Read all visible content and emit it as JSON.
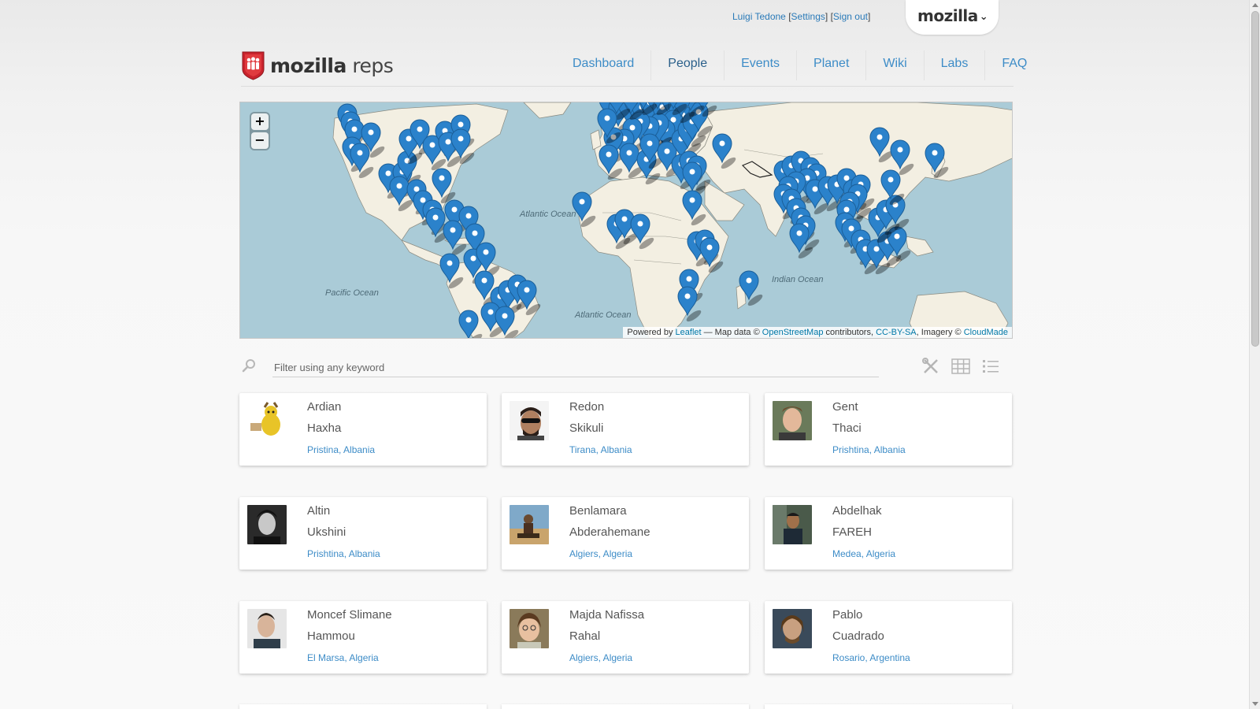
{
  "user_bar": {
    "name": "Luigi Tedone",
    "settings": "Settings",
    "signout": "Sign out"
  },
  "mozilla_tab": {
    "label": "mozilla"
  },
  "logo": {
    "bold": "mozilla",
    "light": "reps"
  },
  "nav": {
    "items": [
      {
        "label": "Dashboard",
        "active": false
      },
      {
        "label": "People",
        "active": true
      },
      {
        "label": "Events",
        "active": false
      },
      {
        "label": "Planet",
        "active": false
      },
      {
        "label": "Wiki",
        "active": false
      },
      {
        "label": "Labs",
        "active": false
      },
      {
        "label": "FAQ",
        "active": false
      }
    ]
  },
  "map": {
    "zoom_in": "+",
    "zoom_out": "−",
    "oceans": [
      {
        "label": "Atlantic Ocean"
      },
      {
        "label": "Pacific Ocean"
      },
      {
        "label": "Atlantic Ocean"
      },
      {
        "label": "Indian Ocean"
      }
    ],
    "attribution": {
      "prefix": "Powered by",
      "leaflet": "Leaflet",
      "mid": "— Map data ©",
      "osm": "OpenStreetMap",
      "contributors": "contributors,",
      "license": "CC-BY-SA",
      "imagery": ", Imagery ©",
      "cloudmade": "CloudMade"
    },
    "colors": {
      "water": "#aacbd7",
      "land": "#f3efe2",
      "marker": "#2b82cb"
    }
  },
  "search": {
    "placeholder": "Filter using any keyword",
    "value": ""
  },
  "view_icons": [
    "tools-icon",
    "grid-view-icon",
    "list-view-icon"
  ],
  "reps": [
    {
      "first": "Ardian",
      "last": "Haxha",
      "location": "Pristina, Albania"
    },
    {
      "first": "Redon",
      "last": "Skikuli",
      "location": "Tirana, Albania"
    },
    {
      "first": "Gent",
      "last": "Thaci",
      "location": "Prishtina, Albania"
    },
    {
      "first": "Altin",
      "last": "Ukshini",
      "location": "Prishtina, Albania"
    },
    {
      "first": "Benlamara",
      "last": "Abderahemane",
      "location": "Algiers, Algeria"
    },
    {
      "first": "Abdelhak",
      "last": "FAREH",
      "location": "Medea, Algeria"
    },
    {
      "first": "Moncef Slimane",
      "last": "Hammou",
      "location": "El Marsa, Algeria"
    },
    {
      "first": "Majda Nafissa",
      "last": "Rahal",
      "location": "Algiers, Algeria"
    },
    {
      "first": "Pablo",
      "last": "Cuadrado",
      "location": "Rosario, Argentina"
    }
  ]
}
